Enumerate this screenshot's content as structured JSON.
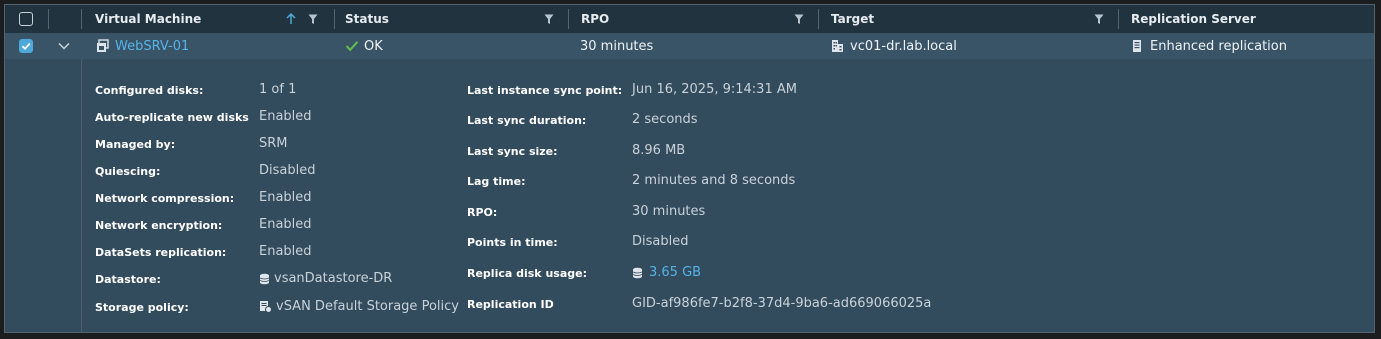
{
  "columns": {
    "vm": "Virtual Machine",
    "status": "Status",
    "rpo": "RPO",
    "target": "Target",
    "server": "Replication Server"
  },
  "row": {
    "vm_name": "WebSRV-01",
    "status": "OK",
    "rpo": "30 minutes",
    "target": "vc01-dr.lab.local",
    "server": "Enhanced replication",
    "selected": true
  },
  "details_left": [
    {
      "label": "Configured disks:",
      "value": "1 of 1"
    },
    {
      "label": "Auto-replicate new disks",
      "value": "Enabled"
    },
    {
      "label": "Managed by:",
      "value": "SRM"
    },
    {
      "label": "Quiescing:",
      "value": "Disabled"
    },
    {
      "label": "Network compression:",
      "value": "Enabled"
    },
    {
      "label": "Network encryption:",
      "value": "Enabled"
    },
    {
      "label": "DataSets replication:",
      "value": "Enabled"
    },
    {
      "label": "Datastore:",
      "value": "vsanDatastore-DR",
      "icon": "datastore-icon"
    },
    {
      "label": "Storage policy:",
      "value": "vSAN Default Storage Policy",
      "icon": "storage-policy-icon"
    }
  ],
  "details_right": [
    {
      "label": "Last instance sync point:",
      "value": "Jun 16, 2025, 9:14:31 AM"
    },
    {
      "label": "Last sync duration:",
      "value": "2 seconds"
    },
    {
      "label": "Last sync size:",
      "value": "8.96 MB"
    },
    {
      "label": "Lag time:",
      "value": "2 minutes and 8 seconds"
    },
    {
      "label": "RPO:",
      "value": "30 minutes"
    },
    {
      "label": "Points in time:",
      "value": "Disabled"
    },
    {
      "label": "Replica disk usage:",
      "value": "3.65 GB",
      "icon": "disk-usage-icon"
    },
    {
      "label": "Replication ID",
      "value": "GID-af986fe7-b2f8-37d4-9ba6-ad669066025a"
    }
  ],
  "colors": {
    "accent": "#4fa8dc",
    "link": "#56b3e8",
    "ok": "#5fbf4a",
    "header_bg": "#21333f",
    "row_bg": "#3a5467",
    "panel_bg": "#324b5d"
  }
}
